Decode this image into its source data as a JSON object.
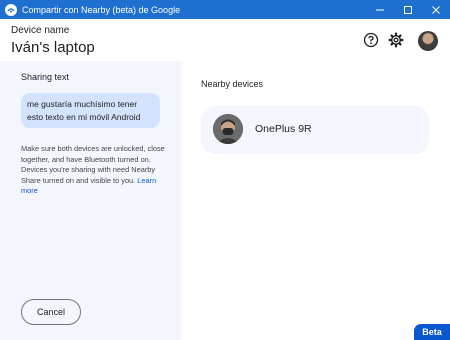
{
  "window": {
    "title": "Compartir con Nearby (beta) de Google",
    "icon": "nearby-share-icon",
    "controls": [
      "minimize-icon",
      "maximize-icon",
      "close-icon"
    ]
  },
  "header": {
    "device_label": "Device name",
    "device_name": "Iván's laptop",
    "icons": [
      "help-icon",
      "settings-icon",
      "avatar"
    ]
  },
  "left": {
    "sharing_label": "Sharing text",
    "shared_text": "me gustaría muchísimo tener esto texto en mi móvil Android",
    "help_text": "Make sure both devices are unlocked, close together, and have Bluetooth turned on. Devices you're sharing with need Nearby Share turned on and visible to you.",
    "learn_more": "Learn more",
    "cancel_label": "Cancel"
  },
  "right": {
    "nearby_label": "Nearby devices",
    "devices": [
      {
        "name": "OnePlus 9R"
      }
    ]
  },
  "badge": {
    "label": "Beta"
  },
  "colors": {
    "titlebar": "#1f6fd1",
    "left_panel": "#f3f6fc",
    "bubble": "#d3e3fd",
    "link": "#0b57d0",
    "badge": "#0b57d0"
  }
}
